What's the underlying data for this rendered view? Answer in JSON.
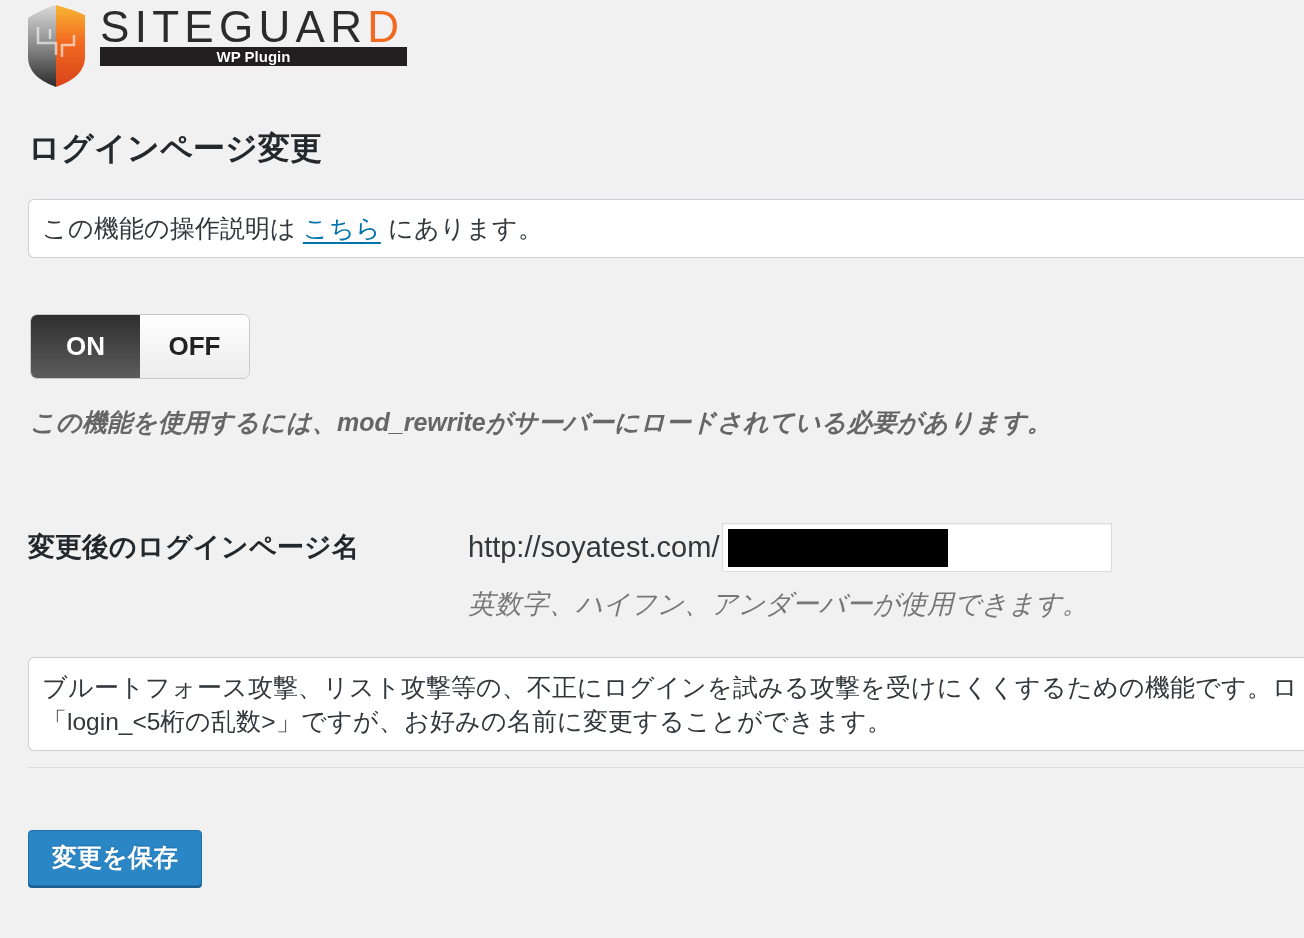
{
  "logo": {
    "title": "SITEGUAR",
    "title_accent": "D",
    "subtitle": "WP Plugin"
  },
  "page_title": "ログインページ変更",
  "notice": {
    "before": "この機能の操作説明は",
    "link": "こちら",
    "after": "にあります。"
  },
  "toggle": [
    {
      "label": "ON",
      "selected": true
    },
    {
      "label": "OFF",
      "selected": false
    }
  ],
  "requirement_note": "この機能を使用するには、mod_rewriteがサーバーにロードされている必要があります。",
  "login_page": {
    "label": "変更後のログインページ名",
    "prefix": "http://soyatest.com/",
    "redacted": true,
    "help": "英数字、ハイフン、アンダーバーが使用できます。"
  },
  "description_lines": [
    "ブルートフォース攻撃、リスト攻撃等の、不正にログインを試みる攻撃を受けにくくするための機能です。ロ",
    "「login_<5桁の乱数>」ですが、お好みの名前に変更することができます。"
  ],
  "save_button": "変更を保存"
}
